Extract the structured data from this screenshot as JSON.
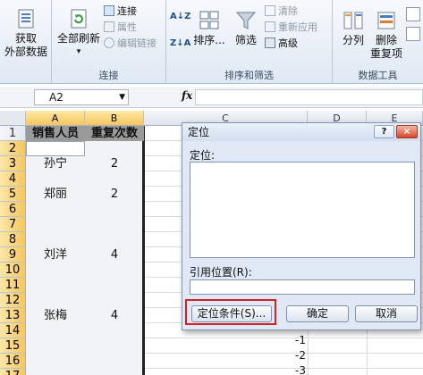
{
  "ribbon": {
    "get_data": {
      "line1": "获取",
      "line2": "外部数据"
    },
    "refresh_all": "全部刷新",
    "connections": {
      "label": "连接",
      "properties": "属性",
      "edit_links": "编辑链接"
    },
    "group_connections": "连接",
    "sort_az": "A↓Z",
    "sort_za": "Z↓A",
    "sort": "排序...",
    "filter": "筛选",
    "clear": "清除",
    "reapply": "重新应用",
    "advanced": "高级",
    "group_sort_filter": "排序和筛选",
    "text_to_columns": "分列",
    "remove_duplicates": {
      "line1": "删除",
      "line2": "重复项"
    },
    "group_data_tools": "数据工具"
  },
  "formula_bar": {
    "name_box": "A2",
    "fx": "fx",
    "formula": ""
  },
  "columns": [
    "A",
    "B",
    "C",
    "D",
    "E"
  ],
  "rows": [
    "1",
    "2",
    "3",
    "4",
    "5",
    "6",
    "7",
    "8",
    "9",
    "10",
    "11",
    "12",
    "13",
    "14",
    "15",
    "16",
    "17"
  ],
  "cells": {
    "A1": "销售人员",
    "B1": "重复次数",
    "A3": "孙宁",
    "B3": "2",
    "A5": "郑丽",
    "B5": "2",
    "A9": "刘洋",
    "B9": "4",
    "A13": "张梅",
    "B13": "4",
    "C15": "-1",
    "C16": "-2",
    "C17": "-3"
  },
  "dialog": {
    "title": "定位",
    "help": "?",
    "close": "×",
    "goto_label": "定位:",
    "reference_label": "引用位置(R):",
    "reference_value": "",
    "special_button": "定位条件(S)...",
    "ok_button": "确定",
    "cancel_button": "取消"
  },
  "colors": {
    "highlight": "#d32020",
    "header_selected": "#f6c65c"
  }
}
